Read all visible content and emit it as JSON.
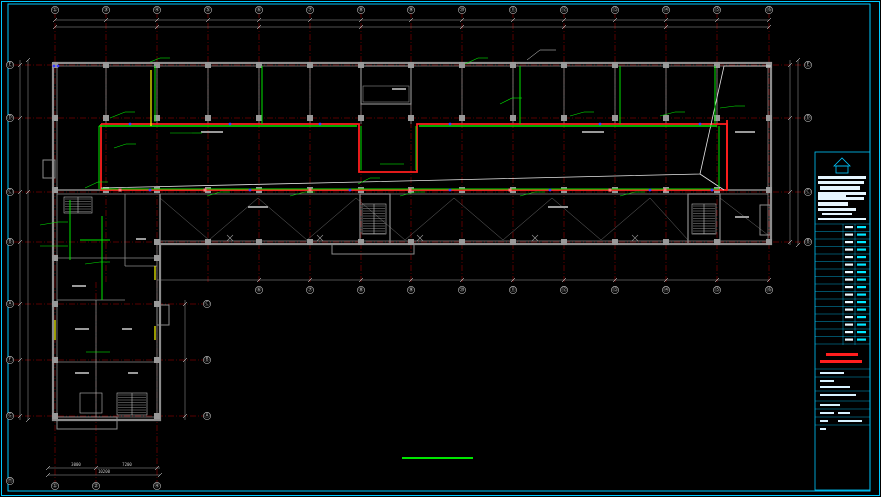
{
  "drawing": {
    "type": "electrical-floor-plan",
    "colors": {
      "background": "#000000",
      "frame": "#00c8ff",
      "wall": "#8c8c8c",
      "grid_axis": "#b00000",
      "fire_circuit": "#ff1e1e",
      "lighting_circuit": "#00e600",
      "signal_circuit": "#ffff00",
      "route_line": "#e6e6e6",
      "device": "#3c3cff",
      "title_block": "#00c8ff"
    },
    "icons": [
      "building-logo-icon",
      "stair-hatch-icon",
      "column-icon"
    ]
  },
  "axes": {
    "top_numbers": [
      "①",
      "③",
      "④",
      "⑤",
      "⑥",
      "⑦",
      "⑧",
      "⑨",
      "⑩",
      "⑪",
      "⑫",
      "⑬",
      "⑭",
      "⑮",
      "⑯"
    ],
    "middle_numbers": [
      "⑥",
      "⑦",
      "⑧",
      "⑨",
      "⑩",
      "⑪",
      "⑫",
      "⑬",
      "⑭",
      "⑮",
      "⑯"
    ],
    "bottom_numbers": [
      "①",
      "②",
      "④"
    ],
    "left_letters": [
      "Ⓔ",
      "Ⓓ",
      "Ⓒ",
      "Ⓑ",
      "Ⓐ",
      "Ⓕ",
      "Ⓖ",
      "Ⓗ"
    ],
    "right_letters": [
      "Ⓔ",
      "Ⓓ",
      "Ⓒ",
      "Ⓑ"
    ],
    "wing_right_letters": [
      "Ⓒ",
      "Ⓑ",
      "Ⓐ"
    ]
  },
  "dimensions": {
    "bottom": [
      "3000",
      "7200"
    ],
    "bottom_total": "10200"
  },
  "title_block": {
    "logo": "building-logo-icon"
  }
}
